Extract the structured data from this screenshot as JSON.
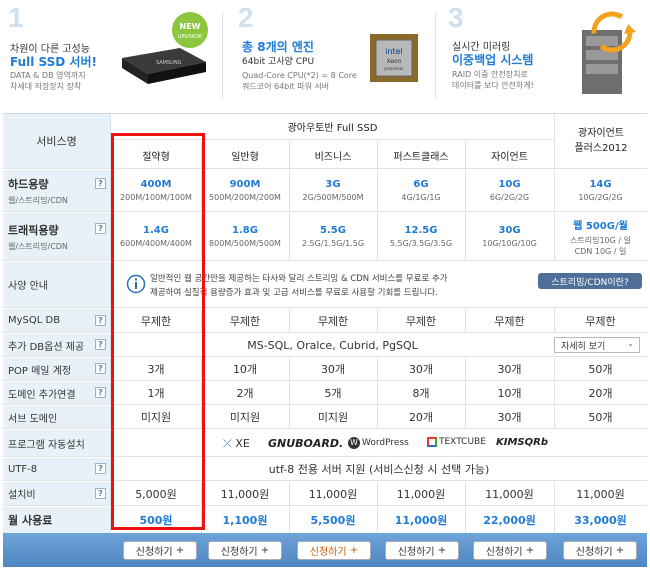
{
  "banner": {
    "feature1": {
      "num": "1",
      "t1": "차원이 다른 고성능",
      "t2": "Full SSD 서버!",
      "t3a": "DATA & DB 영역까지",
      "t3b": "차세대 저장장치 장착",
      "badge1": "NEW",
      "badge2": "UPGRADE",
      "ssd_brand": "SAMSUNG"
    },
    "feature2": {
      "num": "2",
      "t2": "총 8개의 엔진",
      "t1": "64bit 고사양 CPU",
      "t3a": "Quad-Core CPU(*2) = 8 Core",
      "t3b": "쿼드코어 64bit 파워 서버",
      "cpu_brand": "intel",
      "cpu_model": "Xeon",
      "cpu_sub": "processor"
    },
    "feature3": {
      "num": "3",
      "t1": "실시간 미러링",
      "t2": "이중백업 시스템",
      "t3a": "RAID 이중 안전장치로",
      "t3b": "데이터를 보다 안전하게!"
    }
  },
  "table": {
    "service_label": "서비스명",
    "group_label": "광아우토반 Full SSD",
    "client_label": "광자이언트\n플러스2012",
    "plans": [
      "절약형",
      "일반형",
      "비즈니스",
      "퍼스트클래스",
      "자이언트"
    ],
    "rows": {
      "disk": {
        "label": "하드용량",
        "sub": "웹/스트리밍/CDN",
        "values": [
          "400M",
          "900M",
          "3G",
          "6G",
          "10G",
          "14G"
        ],
        "subs": [
          "200M/100M/100M",
          "500M/200M/200M",
          "2G/500M/500M",
          "4G/1G/1G",
          "6G/2G/2G",
          "10G/2G/2G"
        ]
      },
      "traffic": {
        "label": "트래픽용량",
        "sub": "웹/스트리밍/CDN",
        "values": [
          "1.4G",
          "1.8G",
          "5.5G",
          "12.5G",
          "30G",
          "웹 500G/월"
        ],
        "subs": [
          "600M/400M/400M",
          "800M/500M/500M",
          "2.5G/1.5G/1.5G",
          "5.5G/3.5G/3.5G",
          "10G/10G/10G",
          "스트리밍10G / 일\nCDN 10G / 일"
        ]
      },
      "spec": {
        "label": "사양 안내",
        "notice1": "일반적인 웹 공간만을 제공하는 타사와 달리 스트리밍 & CDN 서비스를 무료로 추가",
        "notice2": "제공하여 실질적 용량증가 효과 및 고급 서비스를 무료로 사용할 기회를 드립니다.",
        "button": "스트리밍/CDN이란?"
      },
      "mysql": {
        "label": "MySQL DB",
        "values": [
          "무제한",
          "무제한",
          "무제한",
          "무제한",
          "무제한",
          "무제한"
        ]
      },
      "dbopt": {
        "label": "추가 DB옵션 제공",
        "text": "MS-SQL, Oralce, Cubrid, PgSQL",
        "select": "자세히 보기"
      },
      "pop": {
        "label": "POP 메일 계정",
        "values": [
          "3개",
          "10개",
          "30개",
          "30개",
          "30개",
          "50개"
        ]
      },
      "domain": {
        "label": "도메인 추가연결",
        "values": [
          "1개",
          "2개",
          "5개",
          "8개",
          "10개",
          "20개"
        ]
      },
      "subdomain": {
        "label": "서브 도메인",
        "values": [
          "미지원",
          "미지원",
          "미지원",
          "20개",
          "30개",
          "50개"
        ]
      },
      "autoinstall": {
        "label": "프로그램 자동설치",
        "logos": [
          "XE",
          "GNUBOARD.",
          "WordPress",
          "TEXTCUBE",
          "KIMSQRb"
        ]
      },
      "utf8": {
        "label": "UTF-8",
        "text": "utf-8 전용 서버 지원 (서비스신청 시 선택 가능)"
      },
      "setup": {
        "label": "설치비",
        "values": [
          "5,000원",
          "11,000원",
          "11,000원",
          "11,000원",
          "11,000원",
          "11,000원"
        ]
      },
      "monthly": {
        "label": "월 사용료",
        "values": [
          "500원",
          "1,100원",
          "5,500원",
          "11,000원",
          "22,000원",
          "33,000원"
        ]
      }
    },
    "apply_label": "신청하기"
  },
  "colors": {
    "accent": "#1f7bd4",
    "highlight_box": "#ee1111",
    "label_bg": "#e9f1f8",
    "header_bg": "#4f86c2"
  }
}
